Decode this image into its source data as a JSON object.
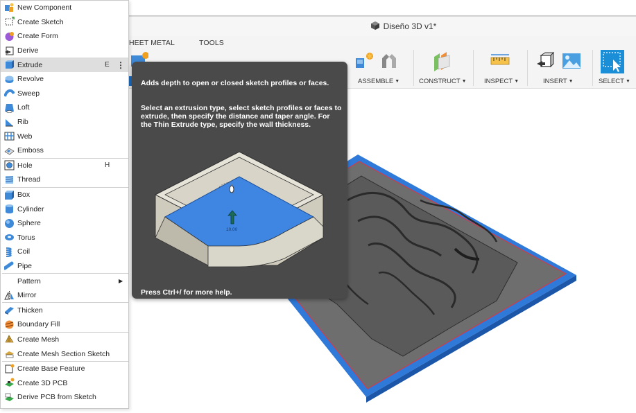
{
  "window": {
    "title": "Diseño 3D v1*",
    "title_icon": "cube-icon"
  },
  "toolbar": {
    "tabs": [
      "HEET METAL",
      "TOOLS"
    ],
    "groups": [
      {
        "label": "ASSEMBLE",
        "icon": "assemble-icon"
      },
      {
        "label": "CONSTRUCT",
        "icon": "construct-plane-icon"
      },
      {
        "label": "INSPECT",
        "icon": "measure-icon"
      },
      {
        "label": "INSERT",
        "icon": "insert-image-icon"
      },
      {
        "label": "SELECT",
        "icon": "select-cursor-icon"
      }
    ]
  },
  "menu": {
    "items": [
      {
        "label": "New Component",
        "icon": "new-component-icon"
      },
      {
        "label": "Create Sketch",
        "icon": "create-sketch-icon"
      },
      {
        "label": "Create Form",
        "icon": "create-form-icon"
      },
      {
        "label": "Derive",
        "icon": "derive-icon"
      },
      {
        "label": "Extrude",
        "icon": "extrude-icon",
        "shortcut": "E",
        "more": "⋮",
        "active": true
      },
      {
        "label": "Revolve",
        "icon": "revolve-icon"
      },
      {
        "label": "Sweep",
        "icon": "sweep-icon"
      },
      {
        "label": "Loft",
        "icon": "loft-icon"
      },
      {
        "label": "Rib",
        "icon": "rib-icon"
      },
      {
        "label": "Web",
        "icon": "web-icon"
      },
      {
        "label": "Emboss",
        "icon": "emboss-icon"
      },
      {
        "label": "Hole",
        "icon": "hole-icon",
        "shortcut": "H"
      },
      {
        "label": "Thread",
        "icon": "thread-icon"
      },
      {
        "label": "Box",
        "icon": "box-icon"
      },
      {
        "label": "Cylinder",
        "icon": "cylinder-icon"
      },
      {
        "label": "Sphere",
        "icon": "sphere-icon"
      },
      {
        "label": "Torus",
        "icon": "torus-icon"
      },
      {
        "label": "Coil",
        "icon": "coil-icon"
      },
      {
        "label": "Pipe",
        "icon": "pipe-icon"
      },
      {
        "label": "Pattern",
        "icon": "",
        "submenu": true
      },
      {
        "label": "Mirror",
        "icon": "mirror-icon"
      },
      {
        "label": "Thicken",
        "icon": "thicken-icon"
      },
      {
        "label": "Boundary Fill",
        "icon": "boundary-fill-icon"
      },
      {
        "label": "Create Mesh",
        "icon": "create-mesh-icon"
      },
      {
        "label": "Create Mesh Section Sketch",
        "icon": "mesh-section-sketch-icon"
      },
      {
        "label": "Create Base Feature",
        "icon": "base-feature-icon"
      },
      {
        "label": "Create 3D PCB",
        "icon": "pcb-3d-icon"
      },
      {
        "label": "Derive PCB from Sketch",
        "icon": "derive-pcb-icon"
      }
    ],
    "dividers_after": [
      10,
      12,
      18,
      20,
      22,
      24
    ]
  },
  "tooltip": {
    "title": "Adds depth to open or closed sketch profiles or faces.",
    "body": "Select an extrusion type, select sketch profiles or faces to extrude, then specify the distance and taper angle. For the Thin Extrude type, specify the wall thickness.",
    "illustration_value": "10.00",
    "footer": "Press Ctrl+/ for more help."
  },
  "colors": {
    "accent_blue": "#1d6fc7",
    "tooltip_bg": "#4a4a4a",
    "plate_blue": "#2f79d8",
    "model_gray": "#6a6a6a"
  }
}
